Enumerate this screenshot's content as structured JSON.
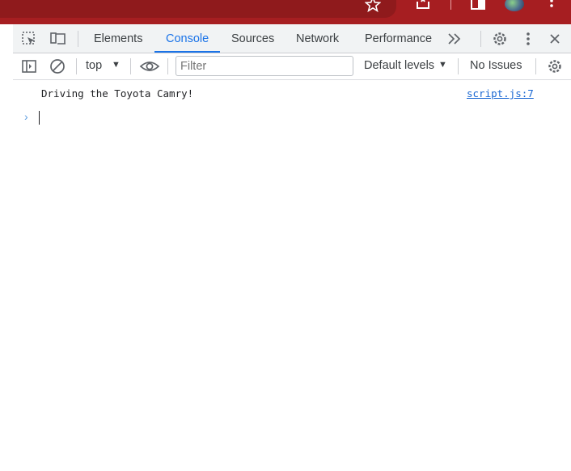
{
  "browser": {
    "icons": [
      "star-icon",
      "extensions-icon",
      "sidebar-icon",
      "avatar",
      "more-vert-icon"
    ]
  },
  "devtools": {
    "tabs": [
      {
        "label": "Elements"
      },
      {
        "label": "Console"
      },
      {
        "label": "Sources"
      },
      {
        "label": "Network"
      },
      {
        "label": "Performance"
      }
    ],
    "active_tab": "Console",
    "accent_color": "#1a73e8"
  },
  "console_toolbar": {
    "context": "top",
    "filter_placeholder": "Filter",
    "levels": "Default levels",
    "issues": "No Issues"
  },
  "console": {
    "messages": [
      {
        "text": "Driving the Toyota Camry!",
        "source": "script.js:7"
      }
    ]
  }
}
